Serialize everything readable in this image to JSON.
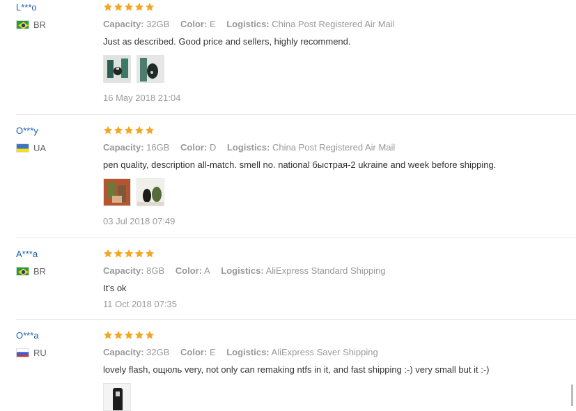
{
  "labels": {
    "capacity": "Capacity:",
    "color": "Color:",
    "logistics": "Logistics:"
  },
  "colors": {
    "username": "#1a5fb4",
    "star": "#f5a623",
    "meta": "#999999"
  },
  "reviews": [
    {
      "user": "L***o",
      "country": "BR",
      "flag": "brazil-flag",
      "rating": 5,
      "capacity": "32GB",
      "color": "E",
      "logistics": "China Post Registered Air Mail",
      "text": "Just as described. Good price and sellers, highly recommend.",
      "photos": [
        "product-photo-1",
        "product-photo-2"
      ],
      "date": "16 May 2018 21:04"
    },
    {
      "user": "O***y",
      "country": "UA",
      "flag": "ukraine-flag",
      "rating": 5,
      "capacity": "16GB",
      "color": "D",
      "logistics": "China Post Registered Air Mail",
      "text": "pen quality, description all-match. smell no. national быстрая-2 ukraine and week before shipping.",
      "photos": [
        "product-photo-1",
        "product-photo-2"
      ],
      "date": "03 Jul 2018 07:49"
    },
    {
      "user": "A***a",
      "country": "BR",
      "flag": "brazil-flag",
      "rating": 5,
      "capacity": "8GB",
      "color": "A",
      "logistics": "AliExpress Standard Shipping",
      "text": "It's ok",
      "photos": [],
      "date": "11 Oct 2018 07:35"
    },
    {
      "user": "O***a",
      "country": "RU",
      "flag": "russia-flag",
      "rating": 5,
      "capacity": "32GB",
      "color": "E",
      "logistics": "AliExpress Saver Shipping",
      "text": "lovely flash, ощюль very, not only can remaking ntfs in it, and fast shipping :-) very small but it :-)",
      "photos": [
        "product-photo-1"
      ],
      "date": ""
    }
  ]
}
